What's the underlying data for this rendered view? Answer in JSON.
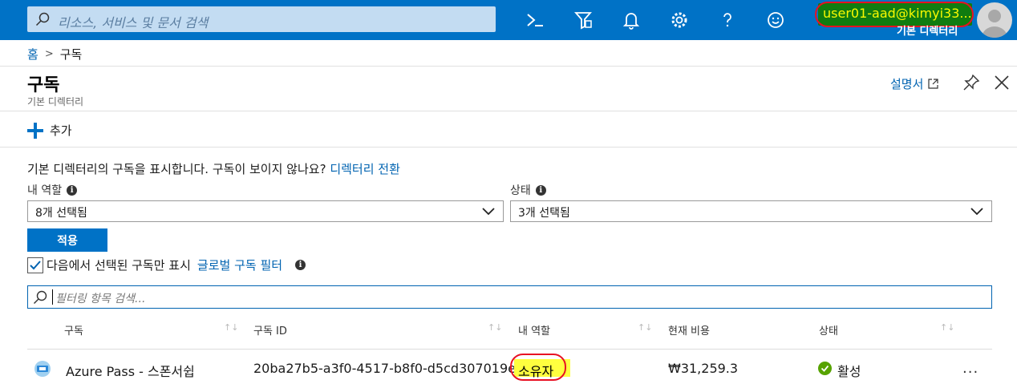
{
  "topbar": {
    "search_placeholder": "리소스, 서비스 및 문서 검색",
    "icons": [
      "cloud-shell-icon",
      "directory-filter-icon",
      "notifications-icon",
      "settings-icon",
      "help-icon",
      "feedback-icon"
    ],
    "user_name": "user01-aad@kimyi33...",
    "directory": "기본 디렉터리"
  },
  "breadcrumb": {
    "home": "홈",
    "current": "구독"
  },
  "blade": {
    "title": "구독",
    "subtitle": "기본 디렉터리",
    "docs_label": "설명서"
  },
  "command": {
    "add_label": "추가"
  },
  "info": {
    "text": "기본 디렉터리의 구독을 표시합니다. 구독이 보이지 않나요?",
    "link": "디렉터리 전환"
  },
  "filters": {
    "role_label": "내 역할",
    "role_value": "8개 선택됨",
    "status_label": "상태",
    "status_value": "3개 선택됨",
    "apply_label": "적용",
    "global_text": "다음에서 선택된 구독만 표시",
    "global_link": "글로벌 구독 필터",
    "global_checked": true,
    "search_placeholder": "필터링 항목 검색..."
  },
  "table": {
    "columns": [
      "구독",
      "구독 ID",
      "내 역할",
      "현재 비용",
      "상태"
    ],
    "rows": [
      {
        "name": "Azure Pass - 스폰서쉽",
        "id": "20ba27b5-a3f0-4517-b8f0-d5cd307019e3",
        "role": "소유자",
        "cost": "₩31,259.3",
        "status": "활성",
        "more": "..."
      }
    ]
  },
  "colors": {
    "brand": "#0072c6",
    "link": "#0063b1",
    "highlight": "#ffff3f",
    "annotation": "#e81123",
    "active": "#57a300"
  }
}
